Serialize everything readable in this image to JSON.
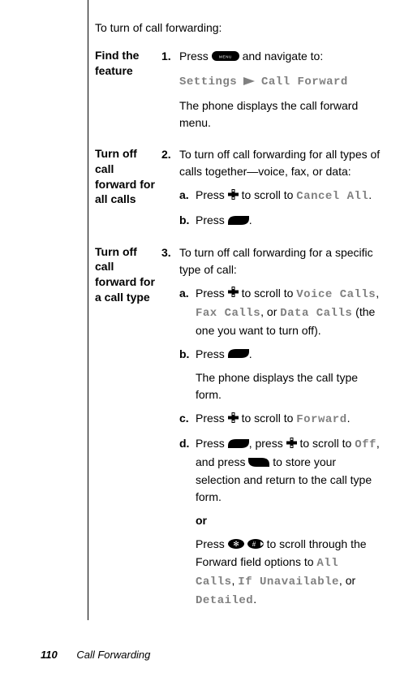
{
  "intro": "To turn of call forwarding:",
  "steps": [
    {
      "label": "Find the feature",
      "num": "1.",
      "text_a": "Press ",
      "text_b": " and navigate to:",
      "path_a": "Settings",
      "path_b": "Call Forward",
      "after": "The phone displays the call forward menu."
    },
    {
      "label": "Turn off call forward for all calls",
      "num": "2.",
      "text": "To turn off call forwarding for all types of calls together—voice, fax, or data:",
      "subs": {
        "a_pre": "Press ",
        "a_mid": " to scroll to ",
        "a_mono": "Cancel All",
        "a_end": ".",
        "b_pre": "Press ",
        "b_end": "."
      }
    },
    {
      "label": "Turn off call forward for a call type",
      "num": "3.",
      "text": "To turn off call forwarding for a specific type of call:",
      "subs": {
        "a_pre": "Press ",
        "a_mid": " to scroll to ",
        "a_m1": "Voice Calls",
        "a_s1": ", ",
        "a_m2": "Fax Calls",
        "a_s2": ", or ",
        "a_m3": "Data Calls",
        "a_end": " (the one you want to turn off).",
        "b_pre": "Press ",
        "b_end": ".",
        "b_after": "The phone displays the call type form.",
        "c_pre": "Press ",
        "c_mid": " to scroll to ",
        "c_mono": "Forward",
        "c_end": ".",
        "d_pre": "Press ",
        "d_mid1": ", press ",
        "d_mid2": " to scroll to ",
        "d_mono1": "Off",
        "d_mid3": ", and press ",
        "d_end": " to store your selection and return to the call type form.",
        "or": "or",
        "or_pre": "Press ",
        "or_mid": " to scroll through the Forward field options to ",
        "or_m1": "All Calls",
        "or_s1": ", ",
        "or_m2": "If Unavailable",
        "or_s2": ", or ",
        "or_m3": "Detailed",
        "or_end": "."
      }
    }
  ],
  "letters": {
    "a": "a.",
    "b": "b.",
    "c": "c.",
    "d": "d."
  },
  "footer": {
    "page": "110",
    "title": "Call Forwarding"
  }
}
